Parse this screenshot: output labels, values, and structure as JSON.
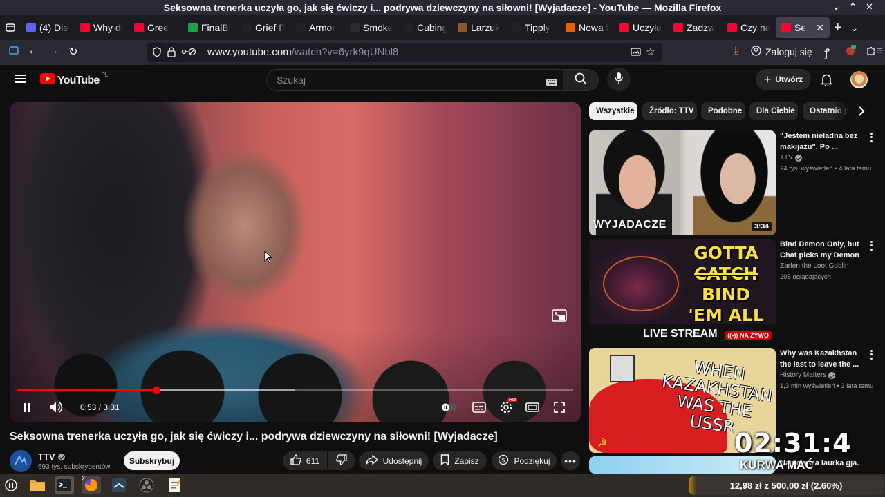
{
  "window": {
    "title": "Seksowna trenerka uczyła go, jak się ćwiczy i... podrywa dziewczyny na siłowni! [Wyjadacze] - YouTube — Mozilla Firefox"
  },
  "tabs": [
    {
      "label": "(4) Disc",
      "color": "#5865f2"
    },
    {
      "label": "Why di",
      "color": "#ff0033"
    },
    {
      "label": "Gree",
      "color": "#ff0033"
    },
    {
      "label": "FinalBl",
      "color": "#1ca34a"
    },
    {
      "label": "Grief R",
      "color": "#222222"
    },
    {
      "label": "Armor",
      "color": "#222222"
    },
    {
      "label": "Smoke Ru",
      "color": "#2b2a33"
    },
    {
      "label": "Cubing",
      "color": "#222222"
    },
    {
      "label": "Larzuk",
      "color": "#8b5a2b"
    },
    {
      "label": "Tipply",
      "color": "#222222"
    },
    {
      "label": "Nowa k",
      "color": "#e66000"
    },
    {
      "label": "Uczyła",
      "color": "#ff0033"
    },
    {
      "label": "Zadzw",
      "color": "#ff0033"
    },
    {
      "label": "Czy na",
      "color": "#ff0033"
    },
    {
      "label": "Se",
      "color": "#ff0033"
    }
  ],
  "nav": {
    "url_host": "www.youtube.com",
    "url_path": "/watch?v=6yrk9qUNbl8",
    "signin": "Zaloguj się"
  },
  "youtube": {
    "logo": "YouTube",
    "country": "PL",
    "search_placeholder": "Szukaj",
    "create_label": "Utwórz"
  },
  "player": {
    "time_current": "0:53",
    "time_total": "3:31",
    "progress_fraction": 0.251,
    "buffered_fraction": 0.5,
    "hd_badge": "HD"
  },
  "video": {
    "title": "Seksowna trenerka uczyła go, jak się ćwiczy i... podrywa dziewczyny na siłowni! [Wyjadacze]",
    "channel": "TTV",
    "subscribers": "693 tys. subskrybentów",
    "subscribe": "Subskrybuj",
    "likes": "611",
    "share": "Udostępnij",
    "save": "Zapisz",
    "thanks": "Podziękuj"
  },
  "chips": [
    "Wszystkie",
    "Źródło: TTV",
    "Podobne",
    "Dla Ciebie",
    "Ostatnio p"
  ],
  "recommendations": [
    {
      "title": "\"Jestem nieładna bez makijażu\". Po ...",
      "channel": "TTV",
      "verified": true,
      "views": "24 tys. wyświetleń",
      "age": "4 lata temu",
      "duration": "3:34",
      "thumb_text": "WYJADACZE"
    },
    {
      "title": "Bind Demon Only, but Chat picks my Demon",
      "channel": "Zarfen the Loot Goblin",
      "verified": false,
      "views": "205 oglądających",
      "age": "",
      "live": "NA ŻYWO",
      "thumb_line1": "GOTTA",
      "thumb_line2_strike": "CATCH",
      "thumb_line2": "BIND",
      "thumb_line3": "'EM ALL",
      "thumb_bottom": "LIVE STREAM"
    },
    {
      "title": "Why was Kazakhstan the last to leave the ...",
      "channel": "History Matters",
      "verified": true,
      "views": "1,3 mln wyświetleń",
      "age": "3 lata temu",
      "thumb_text": "WHEN KAZAKHSTAN WAS THE USSR"
    },
    {
      "title": "Najnowsza laurka gja.",
      "channel": "",
      "views": "",
      "age": ""
    }
  ],
  "overlay": {
    "clock": "02:31:4",
    "clock_label": "KURWA MAĆ"
  },
  "taskbar": {
    "badge": "2",
    "price_text": "12,98 zł z 500,00 zł (2.60%)"
  }
}
